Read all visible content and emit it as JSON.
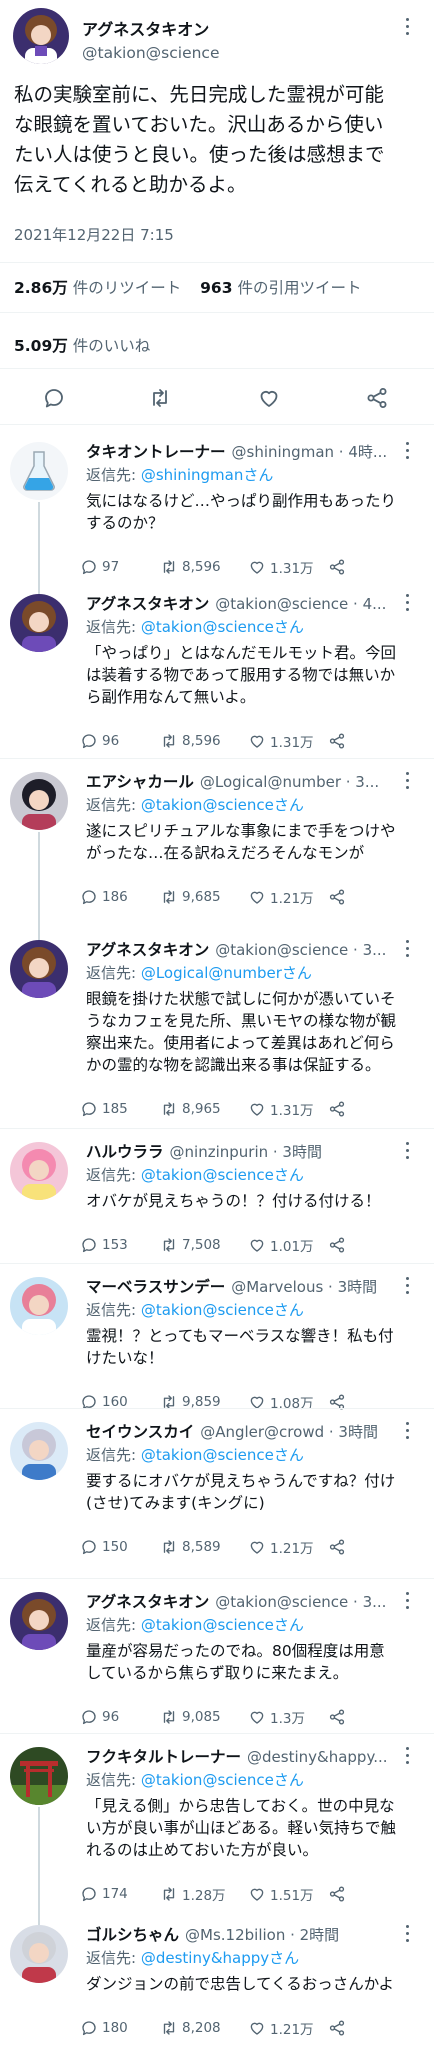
{
  "main_tweet": {
    "author_name": "アグネスタキオン",
    "author_handle": "@takion@science",
    "text_lines": [
      "私の実験室前に、先日完成した霊視が可能",
      "な眼鏡を置いておいた。沢山あるから使い",
      "たい人は使うと良い。使った後は感想まで",
      "伝えてくれると助かるよ。"
    ],
    "timestamp": "2021年12月22日 7:15",
    "retweets_count": "2.86万",
    "retweets_label": "件のリツイート",
    "quotes_count": "963",
    "quotes_label": "件の引用ツイート",
    "likes_count": "5.09万",
    "likes_label": "件のいいね"
  },
  "reply_prefix": "返信先: ",
  "replies": [
    {
      "name": "タキオントレーナー",
      "meta": "@shiningman · 4時...",
      "reply_to": "@shiningmanさん",
      "text": [
        "気にはなるけど…やっぱり副作用もあったり",
        "するのか？"
      ],
      "replies": "97",
      "retweets": "8,596",
      "likes": "1.31万"
    },
    {
      "name": "アグネスタキオン",
      "meta": "@takion@science · 4...",
      "reply_to": "@takion@scienceさん",
      "text": [
        "「やっぱり」とはなんだモルモット君。今回",
        "は装着する物であって服用する物では無いか",
        "ら副作用なんて無いよ。"
      ],
      "replies": "96",
      "retweets": "8,596",
      "likes": "1.31万"
    },
    {
      "name": "エアシャカール",
      "meta": "@Logical@number · 3...",
      "reply_to": "@takion@scienceさん",
      "text": [
        "遂にスピリチュアルな事象にまで手をつけや",
        "がったな…在る訳ねえだろそんなモンが"
      ],
      "replies": "186",
      "retweets": "9,685",
      "likes": "1.21万"
    },
    {
      "name": "アグネスタキオン",
      "meta": "@takion@science · 3...",
      "reply_to": "@Logical@numberさん",
      "text": [
        "眼鏡を掛けた状態で試しに何かが憑いていそ",
        "うなカフェを見た所、黒いモヤの様な物が観",
        "察出来た。使用者によって差異はあれど何ら",
        "かの霊的な物を認識出来る事は保証する。"
      ],
      "replies": "185",
      "retweets": "8,965",
      "likes": "1.31万"
    },
    {
      "name": "ハルウララ",
      "meta": "@ninzinpurin · 3時間",
      "reply_to": "@takion@scienceさん",
      "text": [
        "オバケが見えちゃうの！？付ける付ける！"
      ],
      "replies": "153",
      "retweets": "7,508",
      "likes": "1.01万"
    },
    {
      "name": "マーベラスサンデー",
      "meta": "@Marvelous · 3時間",
      "reply_to": "@takion@scienceさん",
      "text": [
        "霊視！？とってもマーベラスな響き！私も付",
        "けたいな！"
      ],
      "replies": "160",
      "retweets": "9,859",
      "likes": "1.08万"
    },
    {
      "name": "セイウンスカイ",
      "meta": "@Angler@crowd · 3時間",
      "reply_to": "@takion@scienceさん",
      "text": [
        "要するにオバケが見えちゃうんですね？付け",
        "(させ)てみます(キングに)"
      ],
      "replies": "150",
      "retweets": "8,589",
      "likes": "1.21万"
    },
    {
      "name": "アグネスタキオン",
      "meta": "@takion@science · 3...",
      "reply_to": "@takion@scienceさん",
      "text": [
        "量産が容易だったのでね。80個程度は用意",
        "しているから焦らず取りに来たまえ。"
      ],
      "replies": "96",
      "retweets": "9,085",
      "likes": "1.3万"
    },
    {
      "name": "フクキタルトレーナー",
      "meta": "@destiny&happy...",
      "reply_to": "@takion@scienceさん",
      "text": [
        "「見える側」から忠告しておく。世の中見な",
        "い方が良い事が山ほどある。軽い気持ちで触",
        "れるのは止めておいた方が良い。"
      ],
      "replies": "174",
      "retweets": "1.28万",
      "likes": "1.51万"
    },
    {
      "name": "ゴルシちゃん",
      "meta": "@Ms.12bilion · 2時間",
      "reply_to": "@destiny&happyさん",
      "text": [
        "ダンジョンの前で忠告してくるおっさんかよ"
      ],
      "replies": "180",
      "retweets": "8,208",
      "likes": "1.21万"
    }
  ],
  "colors": {
    "text": "#0f1419",
    "muted": "#536471",
    "link": "#1d9bf0",
    "divider": "#eff3f4",
    "thread": "#cfd9de"
  },
  "icons": [
    "reply-icon",
    "retweet-icon",
    "like-icon",
    "share-icon",
    "more-icon",
    "flask-icon"
  ]
}
